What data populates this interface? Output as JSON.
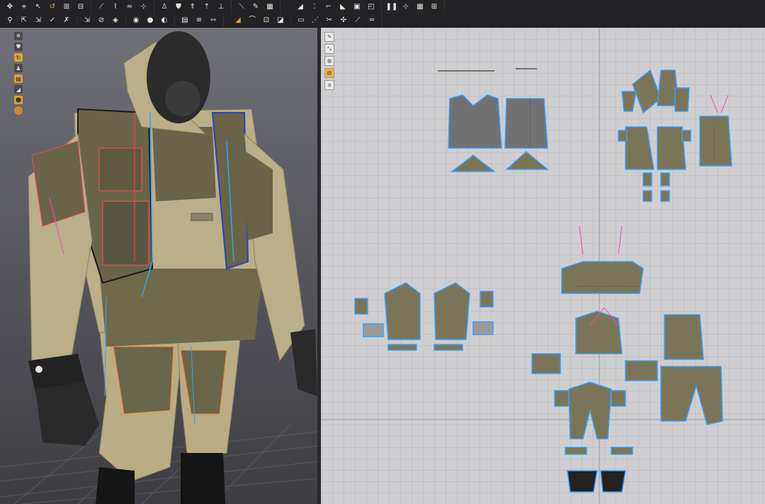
{
  "window": {
    "title": ""
  },
  "toolbar_row1_left": [
    "move",
    "translate",
    "select-pattern",
    "rotate",
    "transform",
    "fold",
    "sew",
    "segment-sew",
    "free-sew",
    "pin",
    "avatar",
    "shirt",
    "arrow",
    "pins",
    "tack",
    "pen",
    "edit",
    "grid"
  ],
  "toolbar_row1_right": [
    "select-2d",
    "transform-2d",
    "edit-points",
    "polygon",
    "rectangle",
    "internal",
    "columns",
    "pin-2d",
    "grid-2d",
    "grid2"
  ],
  "toolbar_row2_left": [
    "arrange",
    "layer-up",
    "layer-down",
    "check",
    "reset",
    "measure",
    "tape",
    "gauge",
    "circle",
    "dot",
    "record",
    "pressure",
    "hand"
  ],
  "toolbar_row2_right": [
    "add-point",
    "curve",
    "select-mesh",
    "trace",
    "texture",
    "symmetric",
    "cut",
    "seam",
    "pleat"
  ],
  "viewport3d": {
    "tools": [
      "hanger-icon",
      "shirt-icon",
      "loop-icon",
      "avatar-icon",
      "garment-icon",
      "eraser-icon",
      "person-icon",
      "ball-icon"
    ]
  },
  "pattern2d": {
    "tools": [
      "pen-icon",
      "transform-icon",
      "circle-icon",
      "layer-icon",
      "text-icon"
    ]
  },
  "colors": {
    "fabric_light": "#b9b08a",
    "fabric_dark": "#6e6a4a",
    "fabric_olive": "#827a56",
    "seam_blue": "#3aa0ff",
    "seam_pink": "#ff40c0",
    "seam_red": "#ff3b3b",
    "skin": "#2b2b2b",
    "grid_bg": "#cfcfd1"
  }
}
